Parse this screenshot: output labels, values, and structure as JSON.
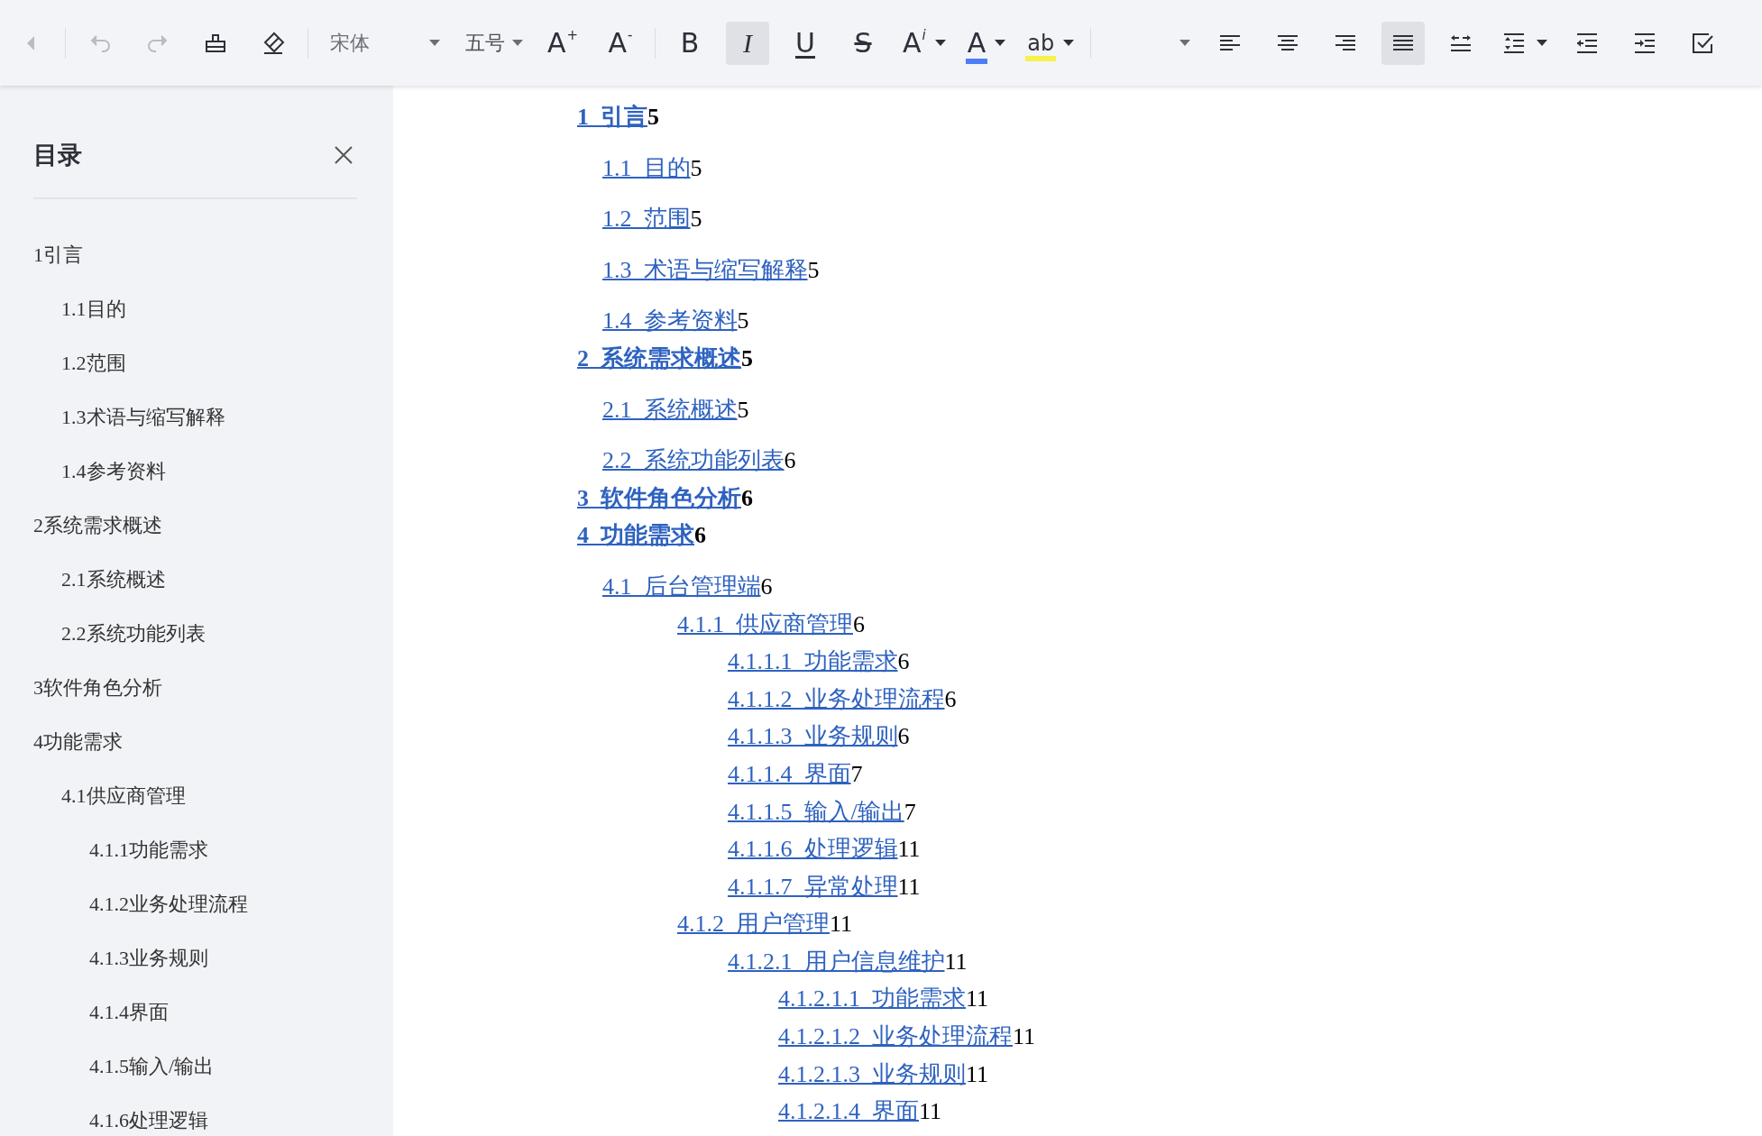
{
  "toolbar": {
    "groups": [
      [
        {
          "kind": "back",
          "disabled": true,
          "selected": false
        }
      ],
      [
        {
          "kind": "undo",
          "disabled": true,
          "selected": false
        },
        {
          "kind": "redo",
          "disabled": true,
          "selected": false
        },
        {
          "kind": "painter",
          "disabled": false,
          "selected": false
        },
        {
          "kind": "eraser",
          "disabled": false,
          "selected": false
        }
      ],
      [
        {
          "kind": "font",
          "label": "宋体",
          "disabled": false,
          "selected": false
        },
        {
          "kind": "size",
          "label": "五号",
          "disabled": false,
          "selected": false
        },
        {
          "kind": "grow",
          "label": "A",
          "sup": "+",
          "disabled": false,
          "selected": false
        },
        {
          "kind": "shrink",
          "label": "A",
          "sup": "-",
          "disabled": false,
          "selected": false
        }
      ],
      [
        {
          "kind": "bold",
          "label": "B",
          "disabled": false,
          "selected": false
        },
        {
          "kind": "italic",
          "label": "I",
          "disabled": false,
          "selected": true
        },
        {
          "kind": "underline",
          "label": "U",
          "disabled": false,
          "selected": false
        },
        {
          "kind": "strike",
          "label": "S",
          "disabled": false,
          "selected": false
        },
        {
          "kind": "superscript",
          "label": "A",
          "sup": "i",
          "disabled": false,
          "selected": false
        },
        {
          "kind": "fontcolor",
          "label": "A",
          "color": "#4d7ef7",
          "disabled": false,
          "selected": false
        },
        {
          "kind": "highlight",
          "label": "ab",
          "color": "#f7f24a",
          "disabled": false,
          "selected": false
        }
      ],
      [
        {
          "kind": "blank-dropdown",
          "disabled": false,
          "selected": false
        },
        {
          "kind": "align-left",
          "disabled": false,
          "selected": false
        },
        {
          "kind": "align-center",
          "disabled": false,
          "selected": false
        },
        {
          "kind": "align-right",
          "disabled": false,
          "selected": false
        },
        {
          "kind": "justify",
          "disabled": false,
          "selected": true
        },
        {
          "kind": "spacing",
          "disabled": false,
          "selected": false
        },
        {
          "kind": "line-spacing",
          "disabled": false,
          "selected": false
        },
        {
          "kind": "outdent",
          "disabled": false,
          "selected": false
        },
        {
          "kind": "indent",
          "disabled": false,
          "selected": false
        },
        {
          "kind": "checkbox",
          "disabled": false,
          "selected": false
        }
      ]
    ]
  },
  "sidebar": {
    "title": "目录",
    "items": [
      {
        "label": "1引言",
        "children": [
          {
            "label": "1.1目的"
          },
          {
            "label": "1.2范围"
          },
          {
            "label": "1.3术语与缩写解释"
          },
          {
            "label": "1.4参考资料"
          }
        ]
      },
      {
        "label": "2系统需求概述",
        "children": [
          {
            "label": "2.1系统概述"
          },
          {
            "label": "2.2系统功能列表"
          }
        ]
      },
      {
        "label": "3软件角色分析"
      },
      {
        "label": "4功能需求",
        "children": [
          {
            "label": "4.1供应商管理",
            "children": [
              {
                "label": "4.1.1功能需求"
              },
              {
                "label": "4.1.2业务处理流程"
              },
              {
                "label": "4.1.3业务规则"
              },
              {
                "label": "4.1.4界面"
              },
              {
                "label": "4.1.5输入/输出"
              },
              {
                "label": "4.1.6处理逻辑"
              }
            ]
          }
        ]
      }
    ]
  },
  "document": {
    "toc": [
      {
        "label": "1  引言",
        "page": "5",
        "children": [
          {
            "label": "1.1  目的",
            "page": "5"
          },
          {
            "label": "1.2  范围",
            "page": "5"
          },
          {
            "label": "1.3  术语与缩写解释",
            "page": "5"
          },
          {
            "label": "1.4  参考资料",
            "page": "5"
          }
        ]
      },
      {
        "label": "2  系统需求概述",
        "page": "5",
        "children": [
          {
            "label": "2.1  系统概述",
            "page": "5"
          },
          {
            "label": "2.2  系统功能列表",
            "page": "6"
          }
        ]
      },
      {
        "label": "3  软件角色分析",
        "page": "6"
      },
      {
        "label": "4  功能需求",
        "page": "6",
        "children": [
          {
            "label": "4.1  后台管理端",
            "page": "6",
            "children": [
              {
                "label": "4.1.1  供应商管理",
                "page": "6",
                "children": [
                  {
                    "label": "4.1.1.1  功能需求",
                    "page": "6"
                  },
                  {
                    "label": "4.1.1.2  业务处理流程",
                    "page": "6"
                  },
                  {
                    "label": "4.1.1.3  业务规则",
                    "page": "6"
                  },
                  {
                    "label": "4.1.1.4  界面",
                    "page": "7"
                  },
                  {
                    "label": "4.1.1.5  输入/输出",
                    "page": "7"
                  },
                  {
                    "label": "4.1.1.6  处理逻辑",
                    "page": "11"
                  },
                  {
                    "label": "4.1.1.7  异常处理",
                    "page": "11"
                  }
                ]
              },
              {
                "label": "4.1.2  用户管理",
                "page": "11",
                "children": [
                  {
                    "label": "4.1.2.1  用户信息维护",
                    "page": "11",
                    "children": [
                      {
                        "label": "4.1.2.1.1  功能需求",
                        "page": "11"
                      },
                      {
                        "label": "4.1.2.1.2  业务处理流程",
                        "page": "11"
                      },
                      {
                        "label": "4.1.2.1.3  业务规则",
                        "page": "11"
                      },
                      {
                        "label": "4.1.2.1.4  界面",
                        "page": "11"
                      }
                    ]
                  }
                ]
              }
            ]
          }
        ]
      }
    ]
  }
}
